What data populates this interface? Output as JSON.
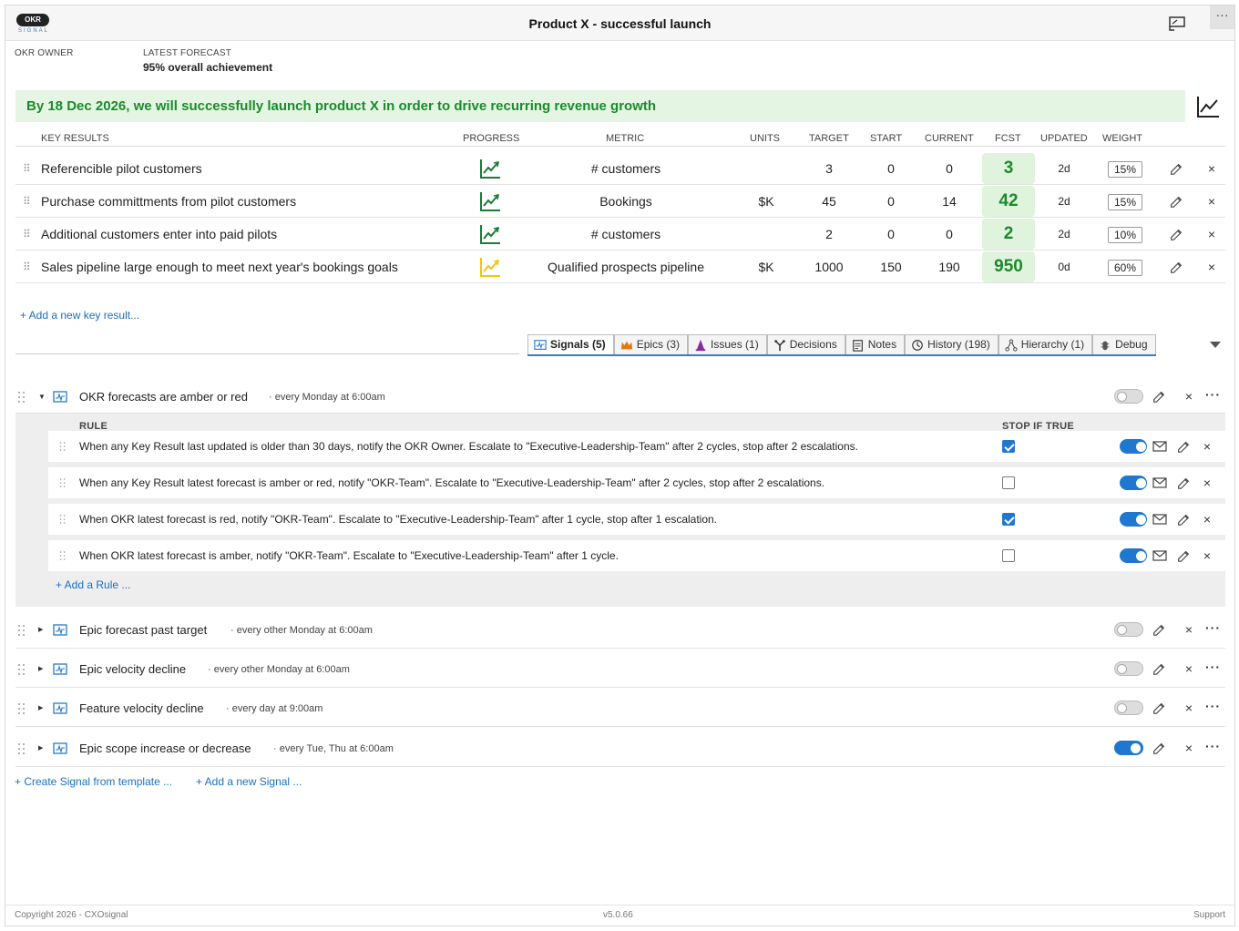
{
  "header": {
    "logo_text": "OKR",
    "logo_sub": "SIGNAL",
    "title": "Product X - successful launch",
    "more": "···"
  },
  "meta": {
    "owner_label": "OKR OWNER",
    "owner_value": "",
    "forecast_label": "LATEST FORECAST",
    "forecast_value": "95% overall achievement"
  },
  "objective": "By 18 Dec 2026, we will successfully launch product X in order to drive recurring revenue growth",
  "kr_columns": {
    "name": "KEY RESULTS",
    "progress": "PROGRESS",
    "metric": "METRIC",
    "units": "UNITS",
    "target": "TARGET",
    "start": "START",
    "current": "CURRENT",
    "fcst": "FCST",
    "updated": "UPDATED",
    "weight": "WEIGHT"
  },
  "key_results": [
    {
      "name": "Referencible pilot customers",
      "progress_color": "#1c7a37",
      "metric": "# customers",
      "units": "",
      "target": "3",
      "start": "0",
      "current": "0",
      "fcst": "3",
      "updated": "2d",
      "weight": "15%"
    },
    {
      "name": "Purchase committments from pilot customers",
      "progress_color": "#1c7a37",
      "metric": "Bookings",
      "units": "$K",
      "target": "45",
      "start": "0",
      "current": "14",
      "fcst": "42",
      "updated": "2d",
      "weight": "15%"
    },
    {
      "name": "Additional customers enter into paid pilots",
      "progress_color": "#1c7a37",
      "metric": "# customers",
      "units": "",
      "target": "2",
      "start": "0",
      "current": "0",
      "fcst": "2",
      "updated": "2d",
      "weight": "10%"
    },
    {
      "name": "Sales pipeline large enough to meet next year's bookings goals",
      "progress_color": "#f2c40f",
      "metric": "Qualified prospects pipeline",
      "units": "$K",
      "target": "1000",
      "start": "150",
      "current": "190",
      "fcst": "950",
      "updated": "0d",
      "weight": "60%"
    }
  ],
  "add_kr": "+ Add a new key result...",
  "tabs": [
    {
      "label": "Signals (5)",
      "icon": "signal-icon",
      "active": true
    },
    {
      "label": "Epics (3)",
      "icon": "crown-icon",
      "active": false
    },
    {
      "label": "Issues (1)",
      "icon": "cone-icon",
      "active": false
    },
    {
      "label": "Decisions",
      "icon": "decision-icon",
      "active": false
    },
    {
      "label": "Notes",
      "icon": "notes-icon",
      "active": false
    },
    {
      "label": "History (198)",
      "icon": "history-icon",
      "active": false
    },
    {
      "label": "Hierarchy (1)",
      "icon": "hierarchy-icon",
      "active": false
    },
    {
      "label": "Debug",
      "icon": "bug-icon",
      "active": false
    }
  ],
  "signals": [
    {
      "name": "OKR forecasts are amber or red",
      "schedule": "· every Monday at 6:00am",
      "enabled": false,
      "expanded": true
    },
    {
      "name": "Epic forecast past target",
      "schedule": "· every other Monday at 6:00am",
      "enabled": false,
      "expanded": false
    },
    {
      "name": "Epic velocity decline",
      "schedule": "· every other Monday at 6:00am",
      "enabled": false,
      "expanded": false
    },
    {
      "name": "Feature velocity decline",
      "schedule": "· every day at 9:00am",
      "enabled": false,
      "expanded": false
    },
    {
      "name": "Epic scope increase or decrease",
      "schedule": "· every Tue, Thu at 6:00am",
      "enabled": true,
      "expanded": false
    }
  ],
  "rules_head": {
    "rule": "RULE",
    "stop": "STOP IF TRUE"
  },
  "rules": [
    {
      "text": "When any Key Result last updated is older than 30 days, notify the OKR Owner. Escalate to \"Executive-Leadership-Team\" after 2 cycles, stop after 2 escalations.",
      "stop": true,
      "enabled": true
    },
    {
      "text": "When any Key Result latest forecast is amber or red, notify \"OKR-Team\". Escalate to \"Executive-Leadership-Team\" after 2 cycles, stop after 2 escalations.",
      "stop": false,
      "enabled": true
    },
    {
      "text": "When OKR latest forecast is red, notify \"OKR-Team\". Escalate to \"Executive-Leadership-Team\" after 1 cycle, stop after 1 escalation.",
      "stop": true,
      "enabled": true
    },
    {
      "text": "When OKR latest forecast is amber, notify \"OKR-Team\". Escalate to \"Executive-Leadership-Team\" after 1 cycle.",
      "stop": false,
      "enabled": true
    }
  ],
  "add_rule": "+ Add a Rule ...",
  "create_signal": "+ Create Signal from template ...",
  "add_signal": "+ Add a new Signal ...",
  "footer": {
    "copyright": "Copyright 2026 - CXOsignal",
    "version": "v5.0.66",
    "support": "Support"
  },
  "colors": {
    "accent": "#1f77d0",
    "green": "#1c8a2b",
    "objective_bg": "#e5f5e4"
  }
}
